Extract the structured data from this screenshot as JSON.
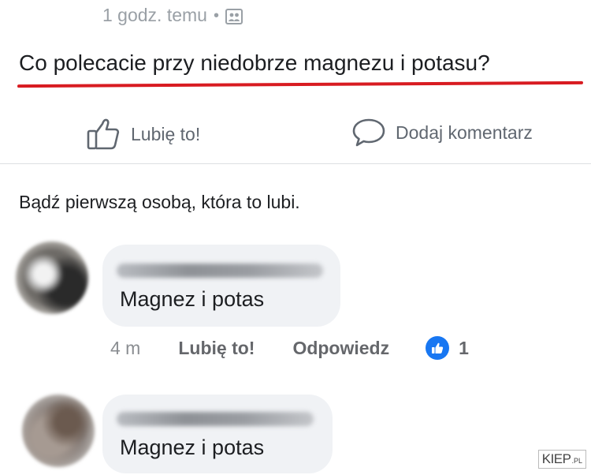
{
  "post": {
    "time": "1 godz. temu",
    "separator": "•",
    "audience_icon": "photo-album-icon",
    "text": "Co polecacie przy niedobrze magnezu i potasu?"
  },
  "actions": {
    "like_label": "Lubię to!",
    "like_icon": "thumbs-up-outline-icon",
    "comment_label": "Dodaj komentarz",
    "comment_icon": "speech-bubble-icon"
  },
  "likes_summary": "Bądź pierwszą osobą, która to lubi.",
  "comments": [
    {
      "text": "Magnez i potas",
      "time": "4 m",
      "like_label": "Lubię to!",
      "reply_label": "Odpowiedz",
      "reaction_count": "1"
    },
    {
      "text": "Magnez i potas"
    }
  ],
  "watermark": {
    "main": "KIEP",
    "suffix": ".PL"
  },
  "colors": {
    "annotation_underline": "#d81b21",
    "like_badge": "#1877f2",
    "bubble_bg": "#f0f2f5"
  }
}
